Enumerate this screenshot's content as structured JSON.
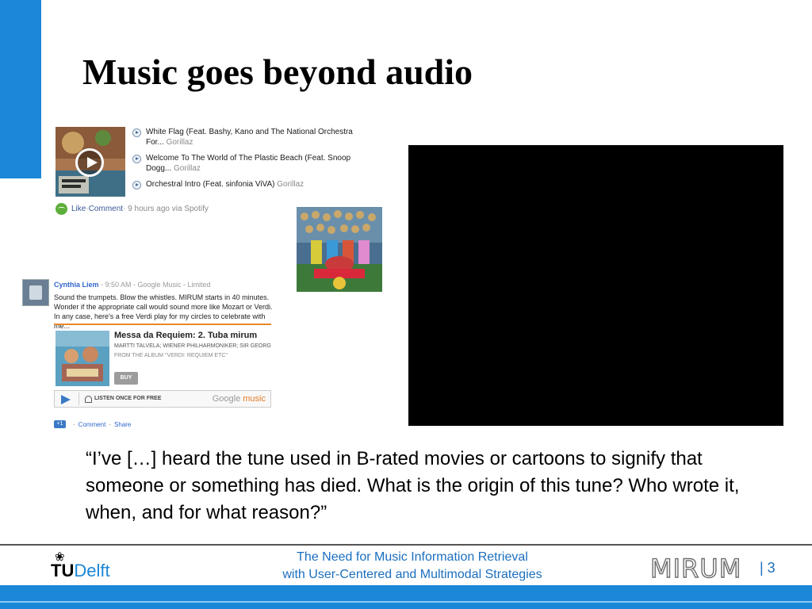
{
  "slide": {
    "title": "Music goes beyond audio",
    "quote": "“I’ve […] heard the tune used in B-rated movies or cartoons to signify that someone or something has died. What is the origin of this tune? Who wrote it, when, and for what reason?”"
  },
  "spotify_post": {
    "tracks": [
      {
        "title": "White Flag (Feat. Bashy, Kano and The National Orchestra For...",
        "artist": "Gorillaz"
      },
      {
        "title": "Welcome To The World of The Plastic Beach (Feat. Snoop Dogg...",
        "artist": "Gorillaz"
      },
      {
        "title": "Orchestral Intro (Feat. sinfonia ViVA)",
        "artist": "Gorillaz"
      }
    ],
    "actions": {
      "like": "Like",
      "sep": " · ",
      "comment": "Comment",
      "meta": " · 9 hours ago via Spotify"
    }
  },
  "gplus_post": {
    "author": "Cynthia Liem",
    "meta": " - 9:50 AM - Google Music - Limited",
    "text": "Sound the trumpets. Blow the whistles. MIRUM starts in 40 minutes. Wonder if the appropriate call would sound more like Mozart or Verdi. In any case, here's a free Verdi play for my circles to celebrate with me...",
    "card": {
      "title": "Messa da Requiem: 2. Tuba mirum",
      "artists": "MARTTI TALVELA; WIENER PHILHARMONIKER; SIR GEORG",
      "album": "FROM THE ALBUM \"VERDI: REQUIEM ETC\"",
      "buy": "BUY",
      "listen": "LISTEN ONCE FOR FREE",
      "brand_google": "Google",
      "brand_music": "music"
    },
    "footer": {
      "plus_one": "+1",
      "comment": "Comment",
      "share": "Share",
      "sep": "-"
    }
  },
  "footer": {
    "logo_tu": "TU",
    "logo_delft": "Delft",
    "line1": "The Need for Music Information Retrieval",
    "line2": "with User-Centered and Multimodal Strategies",
    "mirum": "MIRUM",
    "page": "| 3"
  },
  "colors": {
    "accent": "#1b87d6",
    "footer_text": "#1b6fbf"
  }
}
